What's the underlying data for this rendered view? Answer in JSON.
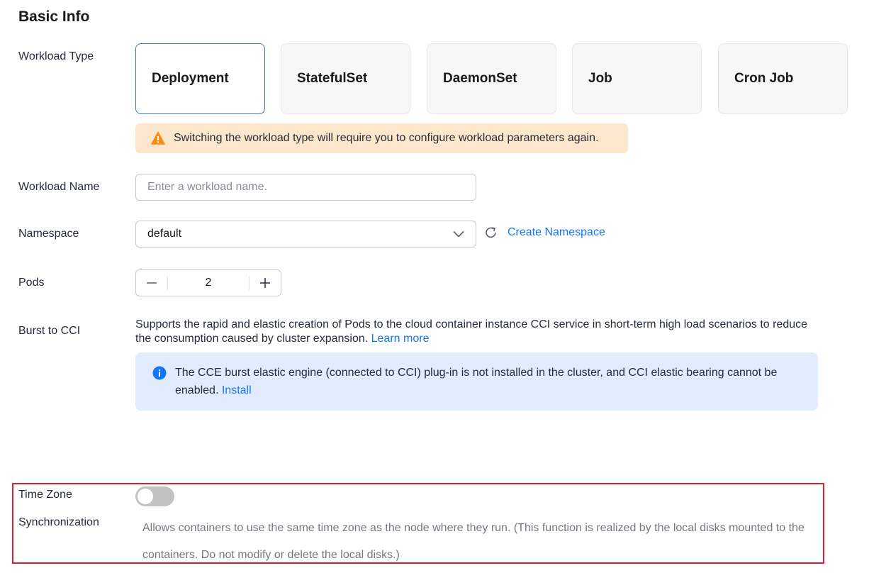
{
  "section": {
    "title": "Basic Info"
  },
  "workload_type": {
    "label": "Workload Type",
    "options": [
      {
        "label": "Deployment",
        "selected": true
      },
      {
        "label": "StatefulSet",
        "selected": false
      },
      {
        "label": "DaemonSet",
        "selected": false
      },
      {
        "label": "Job",
        "selected": false
      },
      {
        "label": "Cron Job",
        "selected": false
      }
    ],
    "warning": "Switching the workload type will require you to configure workload parameters again."
  },
  "workload_name": {
    "label": "Workload Name",
    "value": "",
    "placeholder": "Enter a workload name."
  },
  "namespace": {
    "label": "Namespace",
    "value": "default",
    "create_link": "Create Namespace"
  },
  "pods": {
    "label": "Pods",
    "value": "2"
  },
  "burst": {
    "label": "Burst to CCI",
    "description": "Supports the rapid and elastic creation of Pods to the cloud container instance CCI service in short-term high load scenarios to reduce the consumption caused by cluster expansion.",
    "learn_more": "Learn more",
    "notice": "The CCE burst elastic engine (connected to CCI) plug-in is not installed in the cluster, and CCI elastic bearing cannot be enabled.",
    "install_link": "Install"
  },
  "time_zone": {
    "label_line1": "Time Zone",
    "label_line2": "Synchronization",
    "enabled": false,
    "description": "Allows containers to use the same time zone as the node where they run. (This function is realized by the local disks mounted to the containers. Do not modify or delete the local disks.)"
  },
  "colors": {
    "accent": "#1476ff",
    "selected_border": "#3f79c5",
    "warning_bg": "#fde7cc",
    "warning_icon": "#fa8c16",
    "info_bg": "#e1edfe",
    "info_icon": "#1476ff",
    "highlight_border": "#d7202f"
  },
  "icons": {
    "warning": "warning-triangle-icon",
    "info": "info-circle-icon",
    "refresh": "refresh-icon",
    "dropdown": "chevron-down-icon",
    "minus": "minus-icon",
    "plus": "plus-icon"
  }
}
